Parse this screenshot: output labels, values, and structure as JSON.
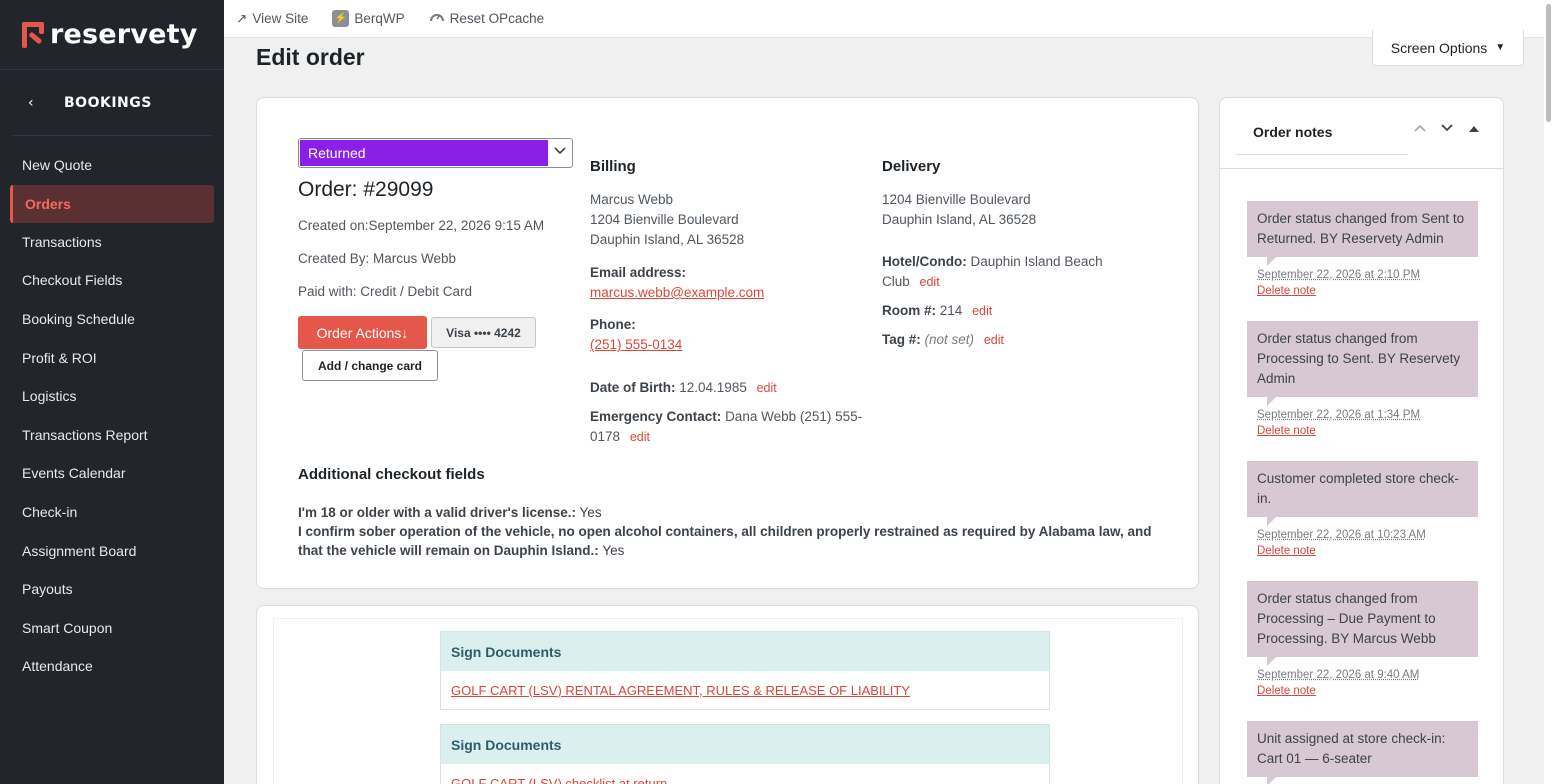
{
  "brand": {
    "name": "reservety",
    "accent": "#e4574a",
    "sidebar_bg": "#23252d"
  },
  "sidebar": {
    "section_title": "BOOKINGS",
    "items": [
      {
        "label": "New Quote"
      },
      {
        "label": "Orders",
        "active": true
      },
      {
        "label": "Transactions"
      },
      {
        "label": "Checkout Fields"
      },
      {
        "label": "Booking Schedule"
      },
      {
        "label": "Profit & ROI"
      },
      {
        "label": "Logistics"
      },
      {
        "label": "Transactions Report"
      },
      {
        "label": "Events Calendar"
      },
      {
        "label": "Check-in"
      },
      {
        "label": "Assignment Board"
      },
      {
        "label": "Payouts"
      },
      {
        "label": "Smart Coupon"
      },
      {
        "label": "Attendance"
      }
    ]
  },
  "adminbar": {
    "view_site": "View Site",
    "berq": "BerqWP",
    "opcache": "Reset OPcache"
  },
  "header": {
    "title": "Edit order",
    "screen_options": "Screen Options"
  },
  "order": {
    "status": "Returned",
    "status_color": "#8a20e8",
    "number": "Order: #29099",
    "created_on": "Created on:September 22, 2026 9:15 AM",
    "created_by": "Created By: Marcus Webb",
    "paid_with": "Paid with: Credit / Debit Card",
    "actions_label": "Order Actions",
    "card_label": "Visa •••• 4242",
    "change_card_label": "Add / change card",
    "edit_label": "edit"
  },
  "billing": {
    "title": "Billing",
    "name": "Marcus Webb",
    "address1": "1204 Bienville Boulevard",
    "address2": "Dauphin Island, AL 36528",
    "email_label": "Email address:",
    "email": "marcus.webb@example.com",
    "phone_label": "Phone:",
    "phone": "(251) 555-0134",
    "dob_label": "Date of Birth:",
    "dob": "12.04.1985",
    "emergency_label": "Emergency Contact:",
    "emergency_line1": "Dana Webb (251) 555-",
    "emergency_line2": "0178"
  },
  "delivery": {
    "title": "Delivery",
    "address1": "1204 Bienville Boulevard",
    "address2": "Dauphin Island, AL 36528",
    "hotel_label": "Hotel/Condo:",
    "hotel_line1": "Dauphin Island Beach",
    "hotel_line2": "Club",
    "room_label": "Room #:",
    "room": "214",
    "tag_label": "Tag #:",
    "tag": "(not set)"
  },
  "additional": {
    "title": "Additional checkout fields",
    "field1_label": "I'm 18 or older with a valid driver's license.:",
    "field1_value": "Yes",
    "field2_label": "I confirm sober operation of the vehicle, no open alcohol containers, all children properly restrained as required by Alabama law, and that the vehicle will remain on Dauphin Island.:",
    "field2_value": "Yes"
  },
  "documents": [
    {
      "head": "Sign Documents",
      "link": "GOLF CART (LSV) RENTAL AGREEMENT, RULES & RELEASE OF LIABILITY"
    },
    {
      "head": "Sign Documents",
      "link": "GOLF CART (LSV) checklist at return"
    }
  ],
  "notes": {
    "title": "Order notes",
    "delete_label": "Delete note",
    "items": [
      {
        "text": "Order status changed from Sent to Returned. BY Reservety Admin",
        "date": "September 22, 2026 at 2:10 PM"
      },
      {
        "text": "Order status changed from Processing to Sent. BY Reservety Admin",
        "date": "September 22, 2026 at 1:34 PM"
      },
      {
        "text": "Customer completed store check-in.",
        "date": "September 22, 2026 at 10:23 AM"
      },
      {
        "text": "Order status changed from Processing – Due Payment to Processing. BY Marcus Webb",
        "date": "September 22, 2026 at 9:40 AM"
      },
      {
        "text": "Unit assigned at store check-in: Cart 01 — 6-seater",
        "date": ""
      }
    ]
  }
}
